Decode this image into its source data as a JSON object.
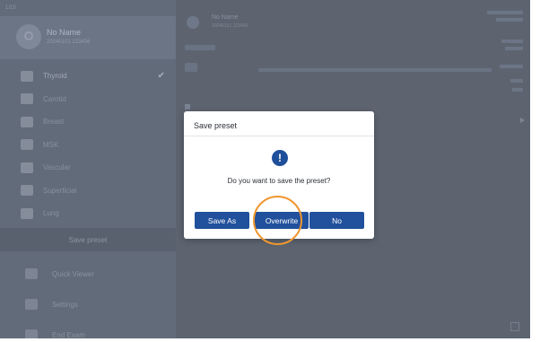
{
  "sidebar": {
    "top_label": "1/15",
    "profile": {
      "name": "No Name",
      "id": "20240101 123456"
    },
    "items": [
      {
        "label": "Thyroid",
        "icon": "thyroid-icon",
        "active": true
      },
      {
        "label": "Carotid",
        "icon": "carotid-icon",
        "active": false
      },
      {
        "label": "Breast",
        "icon": "breast-icon",
        "active": false
      },
      {
        "label": "MSK",
        "icon": "msk-icon",
        "active": false
      },
      {
        "label": "Vascular",
        "icon": "vascular-icon",
        "active": false
      },
      {
        "label": "Superficial",
        "icon": "superficial-icon",
        "active": false
      },
      {
        "label": "Lung",
        "icon": "lung-icon",
        "active": false
      }
    ],
    "save_preset_label": "Save preset",
    "bottom": [
      {
        "label": "Quick Viewer",
        "icon": "quick-viewer-icon"
      },
      {
        "label": "Settings",
        "icon": "gear-icon"
      },
      {
        "label": "End Exam",
        "icon": "exit-icon"
      }
    ]
  },
  "main": {
    "patient_name": "No Name",
    "patient_sub": "20240101 123456"
  },
  "dialog": {
    "title": "Save preset",
    "message": "Do you want to save the preset?",
    "buttons": {
      "save_as": "Save As",
      "overwrite": "Overwrite",
      "no": "No"
    },
    "highlight_color": "#f0962e",
    "button_color": "#21509c"
  }
}
